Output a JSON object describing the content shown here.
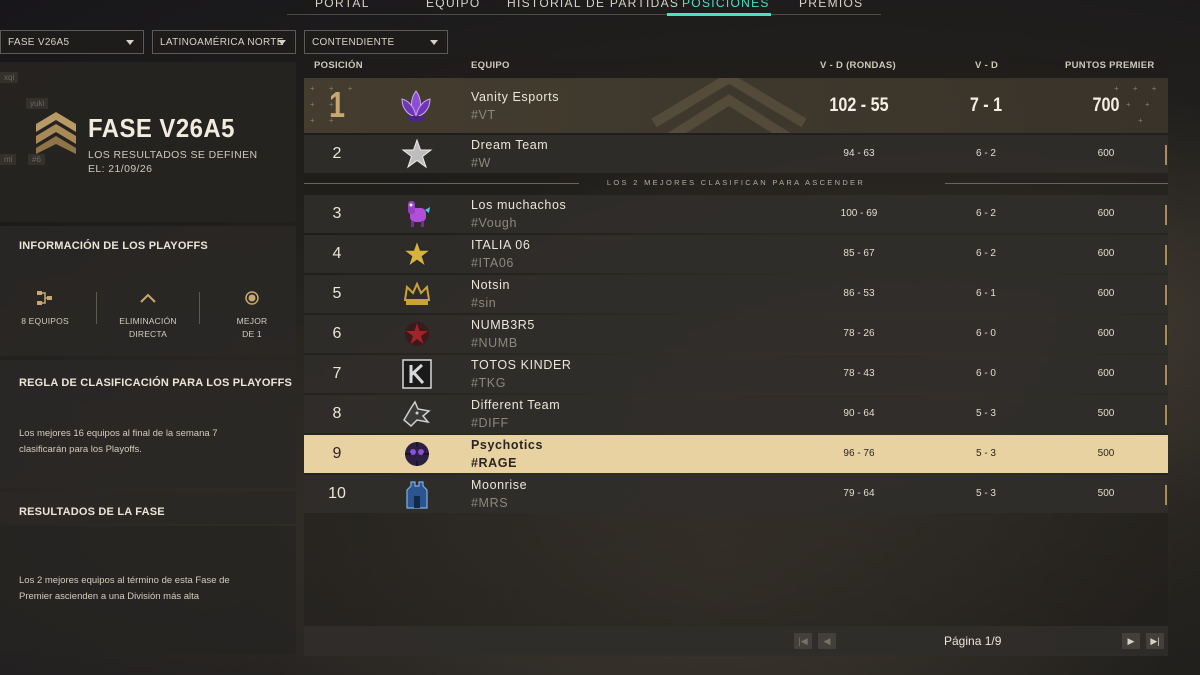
{
  "tabs": [
    {
      "label": "PORTAL",
      "active": false
    },
    {
      "label": "EQUIPO",
      "active": false
    },
    {
      "label": "HISTORIAL DE PARTIDAS",
      "active": false
    },
    {
      "label": "POSICIONES",
      "active": true
    },
    {
      "label": "PREMIOS",
      "active": false
    }
  ],
  "filters": {
    "phase": "FASE V26A5",
    "region": "LATINOAMÉRICA NORTE",
    "division": "CONTENDIENTE"
  },
  "phase_card": {
    "ghost_names": [
      "xqi",
      "yuki",
      "mi",
      "#6"
    ],
    "title": "FASE V26A5",
    "subtitle": "LOS RESULTADOS SE DEFINEN",
    "date": "EL: 21/09/26"
  },
  "playoffs_info": {
    "heading": "INFORMACIÓN DE LOS PLAYOFFS",
    "teams": "8 EQUIPOS",
    "format_line1": "ELIMINACIÓN",
    "format_line2": "DIRECTA",
    "bestof_line1": "MEJOR",
    "bestof_line2": "DE 1"
  },
  "qualification_rule": {
    "heading": "REGLA DE CLASIFICACIÓN PARA LOS PLAYOFFS",
    "text_line1": "Los mejores 16 equipos al final de la semana 7",
    "text_line2": "clasificarán para los Playoffs."
  },
  "phase_results": {
    "heading": "RESULTADOS DE LA FASE",
    "text_line1": "Los 2 mejores equipos al término de esta Fase de",
    "text_line2": "Premier ascienden a una División más alta"
  },
  "table": {
    "columns": {
      "position": "POSICIÓN",
      "team": "EQUIPO",
      "rounds": "V - D (RONDAS)",
      "wl": "V - D",
      "points": "PUNTOS PREMIER"
    },
    "promotion_text": "LOS 2 MEJORES CLASIFICAN PARA ASCENDER",
    "rows": [
      {
        "pos": "1",
        "name": "Vanity Esports",
        "tag": "#VT",
        "rounds": "102 - 55",
        "wl": "7 - 1",
        "points": "700",
        "logo": "lotus-logo-icon",
        "logo_color": "#8b4fd1"
      },
      {
        "pos": "2",
        "name": "Dream Team",
        "tag": "#W",
        "rounds": "94 - 63",
        "wl": "6 - 2",
        "points": "600",
        "logo": "star-logo-icon",
        "logo_color": "#c8c8c8"
      },
      {
        "pos": "3",
        "name": "Los muchachos",
        "tag": "#Vough",
        "rounds": "100 - 69",
        "wl": "6 - 2",
        "points": "600",
        "logo": "llama-logo-icon",
        "logo_color": "#b04fd8"
      },
      {
        "pos": "4",
        "name": "ITALIA 06",
        "tag": "#ITA06",
        "rounds": "85 - 67",
        "wl": "6 - 2",
        "points": "600",
        "logo": "gold-star-logo-icon",
        "logo_color": "#d9b23a"
      },
      {
        "pos": "5",
        "name": "Notsin",
        "tag": "#sin",
        "rounds": "86 - 53",
        "wl": "6 - 1",
        "points": "600",
        "logo": "crown-logo-icon",
        "logo_color": "#c9a23a"
      },
      {
        "pos": "6",
        "name": "NUMB3R5",
        "tag": "#NUMB",
        "rounds": "78 - 26",
        "wl": "6 - 0",
        "points": "600",
        "logo": "red-star-logo-icon",
        "logo_color": "#a0242a"
      },
      {
        "pos": "7",
        "name": "TOTOS KINDER",
        "tag": "#TKG",
        "rounds": "78 - 43",
        "wl": "6 - 0",
        "points": "600",
        "logo": "k-logo-icon",
        "logo_color": "#d8d8d8"
      },
      {
        "pos": "8",
        "name": "Different Team",
        "tag": "#DIFF",
        "rounds": "90 - 64",
        "wl": "5 - 3",
        "points": "500",
        "logo": "wolf-logo-icon",
        "logo_color": "#c8c8c8"
      },
      {
        "pos": "9",
        "name": "Psychotics",
        "tag": "#RAGE",
        "rounds": "96 - 76",
        "wl": "5 - 3",
        "points": "500",
        "logo": "skull-logo-icon",
        "logo_color": "#2c2040"
      },
      {
        "pos": "10",
        "name": "Moonrise",
        "tag": "#MRS",
        "rounds": "79 - 64",
        "wl": "5 - 3",
        "points": "500",
        "logo": "castle-logo-icon",
        "logo_color": "#3b6fb0"
      }
    ]
  },
  "pager": {
    "label": "Página 1/9",
    "first": "|◀",
    "prev": "◀",
    "next": "▶",
    "last": "▶|"
  },
  "colors": {
    "accent": "#4fe0c2",
    "gold": "#c9a870",
    "highlight_row": "#e8d2a2"
  }
}
